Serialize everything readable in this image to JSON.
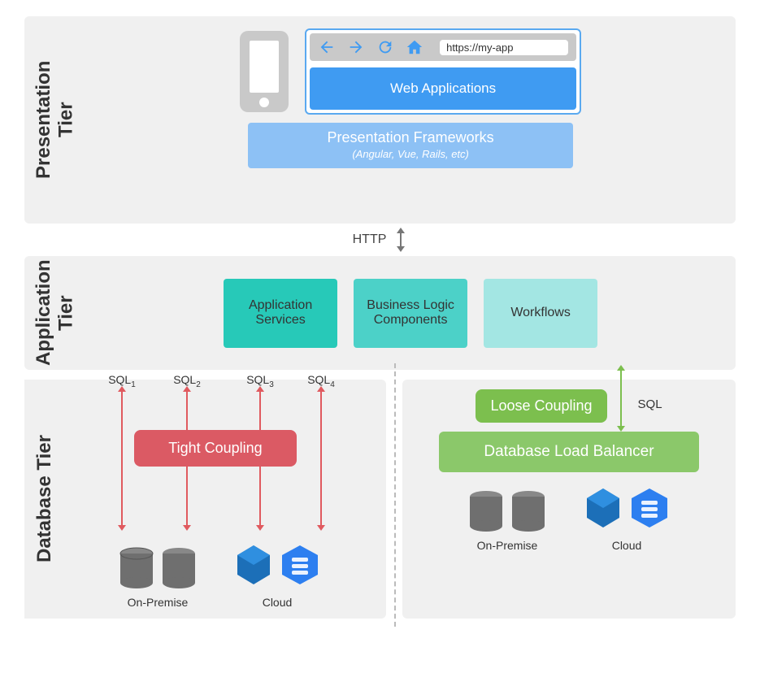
{
  "presentation": {
    "tier_label": "Presentation\nTier",
    "url": "https://my-app",
    "web_applications": "Web Applications",
    "frameworks_title": "Presentation Frameworks",
    "frameworks_sub": "(Angular, Vue, Rails, etc)"
  },
  "http_label": "HTTP",
  "application": {
    "tier_label": "Application\nTier",
    "box1": "Application Services",
    "box2": "Business Logic Components",
    "box3": "Workflows"
  },
  "database": {
    "tier_label": "Database Tier",
    "sql1": "SQL",
    "sql1_sub": "1",
    "sql2": "SQL",
    "sql2_sub": "2",
    "sql3": "SQL",
    "sql3_sub": "3",
    "sql4": "SQL",
    "sql4_sub": "4",
    "tight_coupling": "Tight Coupling",
    "on_premise": "On-Premise",
    "cloud": "Cloud",
    "loose_coupling": "Loose Coupling",
    "sql_right": "SQL",
    "load_balancer": "Database Load Balancer"
  }
}
